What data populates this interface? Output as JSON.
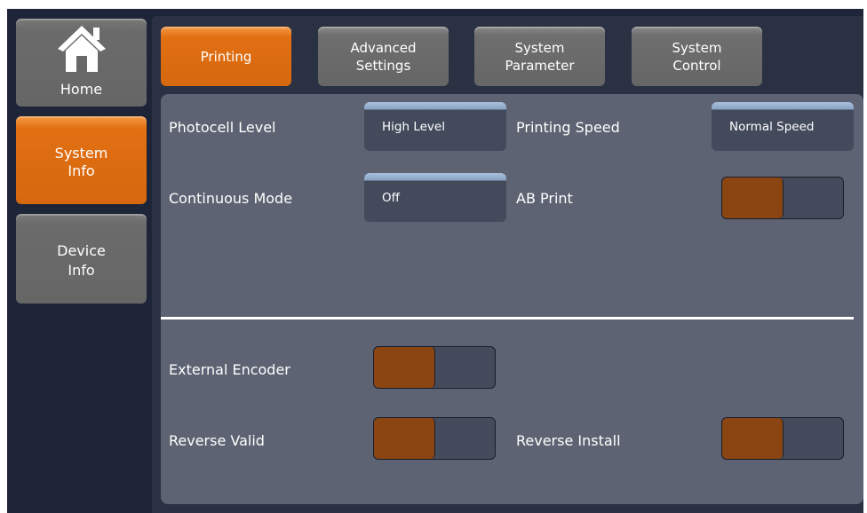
{
  "nav": {
    "home": "Home",
    "system_info_line1": "System",
    "system_info_line2": "Info",
    "device_info_line1": "Device",
    "device_info_line2": "Info"
  },
  "tabs": {
    "printing": "Printing",
    "advanced_line1": "Advanced",
    "advanced_line2": "Settings",
    "sysparam_line1": "System",
    "sysparam_line2": "Parameter",
    "sysctrl_line1": "System",
    "sysctrl_line2": "Control"
  },
  "settings": {
    "photocell_level_label": "Photocell Level",
    "photocell_level_value": "High Level",
    "printing_speed_label": "Printing Speed",
    "printing_speed_value": "Normal Speed",
    "continuous_mode_label": "Continuous Mode",
    "continuous_mode_value": "Off",
    "ab_print_label": "AB Print",
    "external_encoder_label": "External Encoder",
    "reverse_valid_label": "Reverse Valid",
    "reverse_install_label": "Reverse Install"
  },
  "colors": {
    "accent_orange": "#d6680f",
    "toggle_knob": "#8b4513",
    "panel": "#5d6372",
    "background": "#1e2538"
  }
}
